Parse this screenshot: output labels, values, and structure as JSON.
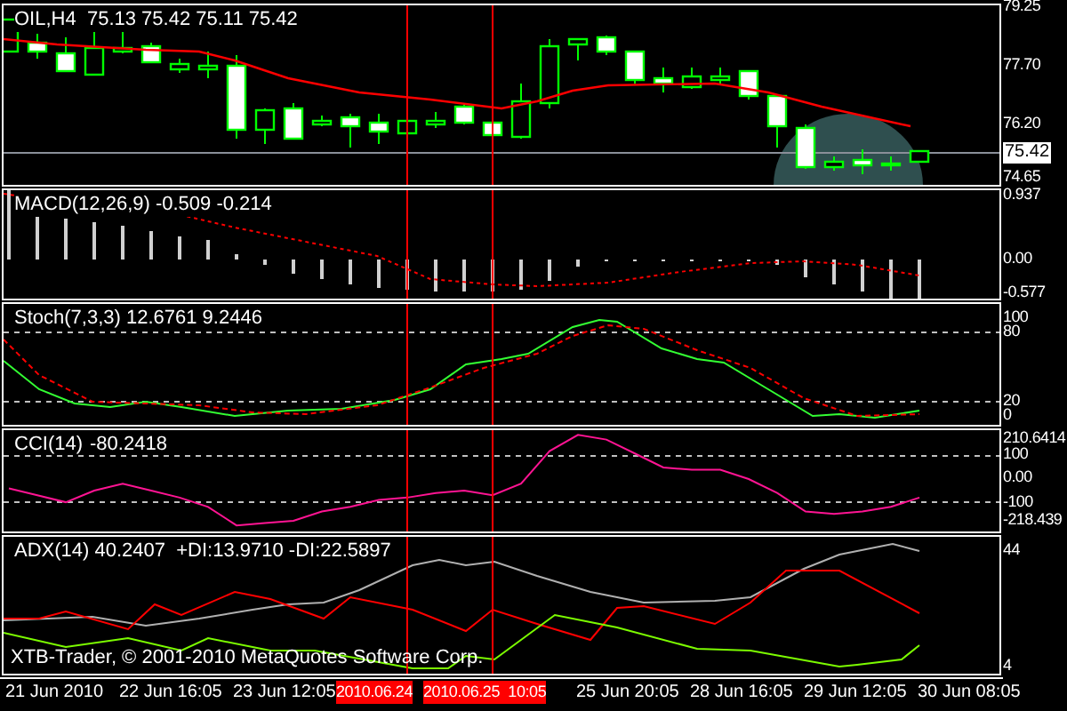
{
  "panes": [
    {
      "kind": "price",
      "title": "OIL,H4  75.13 75.42 75.11 75.42",
      "axis_labels": [
        {
          "text": "79.25",
          "selected": false
        },
        {
          "text": "77.70",
          "selected": false
        },
        {
          "text": "76.20",
          "selected": false
        },
        {
          "text": "75.42",
          "selected": true
        },
        {
          "text": "74.65",
          "selected": false
        }
      ]
    },
    {
      "kind": "macd",
      "title": "MACD(12,26,9) -0.509 -0.214",
      "axis_labels": [
        {
          "text": "0.937",
          "selected": false
        },
        {
          "text": "0.00",
          "selected": false
        },
        {
          "text": "-0.577",
          "selected": false
        }
      ]
    },
    {
      "kind": "stoch",
      "title": "Stoch(7,3,3) 12.6761 9.2446",
      "axis_labels": [
        {
          "text": "100",
          "selected": false
        },
        {
          "text": "80",
          "selected": false
        },
        {
          "text": "20",
          "selected": false
        },
        {
          "text": "0",
          "selected": false
        }
      ]
    },
    {
      "kind": "cci",
      "reading": "-80.2418",
      "axis_labels": [
        {
          "text": "210.6414",
          "selected": false
        },
        {
          "text": "-218.439",
          "selected": false
        }
      ],
      "chart_data": {
        "type": "line",
        "ylim": [
          -218.439,
          210.6414
        ],
        "yticks": [
          {
            "value": 100,
            "label": "100"
          },
          {
            "value": 0,
            "label": "0.00"
          },
          {
            "value": -100,
            "label": "-100"
          }
        ],
        "grid": true,
        "series": [
          {
            "name": "CCI(14)",
            "color": "#ff1493",
            "values": [
              -40,
              -70,
              -100,
              -50,
              -20,
              -50,
              -80,
              -120,
              -200,
              -190,
              -180,
              -140,
              -120,
              -90,
              -80,
              -60,
              -50,
              -70,
              -20,
              120,
              190,
              170,
              110,
              50,
              40,
              40,
              0,
              -60,
              -140,
              -150,
              -140,
              -120,
              -80
            ]
          }
        ]
      }
    },
    {
      "kind": "adx",
      "title": "ADX(14) 40.2407  +DI:13.9710 -DI:22.5897",
      "axis_labels": [
        {
          "text": "44",
          "selected": false
        },
        {
          "text": "4",
          "selected": false
        }
      ]
    }
  ],
  "copyright": "XTB-Trader, © 2001-2010 MetaQuotes Software Corp.",
  "time_axis": [
    {
      "text": "21 Jun 2010",
      "selected": false
    },
    {
      "text": "22 Jun 16:05",
      "selected": false
    },
    {
      "text": "23 Jun 12:05",
      "selected": false
    },
    {
      "text": "2010.06.24",
      "selected": true
    },
    {
      "text": "2010.06.25  10:05",
      "selected": true
    },
    {
      "text": "25 Jun 20:05",
      "selected": false
    },
    {
      "text": "28 Jun 16:05",
      "selected": false
    },
    {
      "text": "29 Jun 12:05",
      "selected": false
    },
    {
      "text": "30 Jun 08:05",
      "selected": false
    }
  ]
}
